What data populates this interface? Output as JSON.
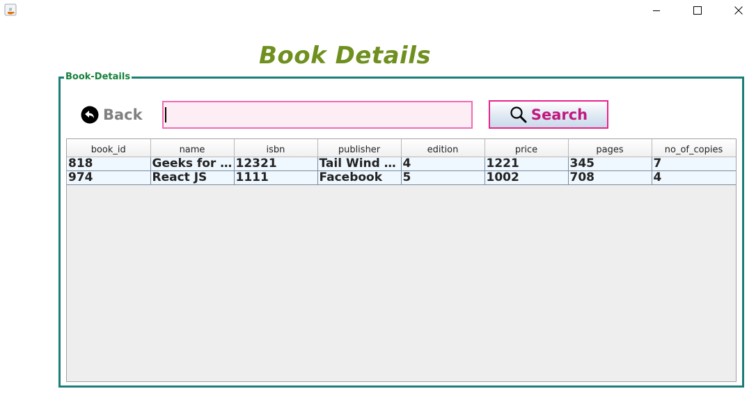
{
  "window": {
    "app_icon": "java-icon",
    "controls": [
      "minimize-icon",
      "maximize-icon",
      "close-icon"
    ]
  },
  "page": {
    "title": "Book Details"
  },
  "panel": {
    "legend": "Book-Details"
  },
  "toolbar": {
    "back_label": "Back",
    "search_label": "Search",
    "search_value": "",
    "search_placeholder": ""
  },
  "table": {
    "columns": [
      "book_id",
      "name",
      "isbn",
      "publisher",
      "edition",
      "price",
      "pages",
      "no_of_copies"
    ],
    "rows": [
      [
        "818",
        "Geeks for Geeks",
        "12321",
        "Tail Wind CSS",
        "4",
        "1221",
        "345",
        "7"
      ],
      [
        "974",
        "React JS",
        "1111",
        "Facebook",
        "5",
        "1002",
        "708",
        "4"
      ]
    ]
  },
  "colors": {
    "title": "#6f8f1f",
    "panel_border": "#1a7e76",
    "legend": "#14813a",
    "search_border": "#f06ab4",
    "search_bg": "#fdeef5",
    "button_border": "#e8218a",
    "button_text": "#c2187e",
    "row_bg": "#f0f8ff"
  }
}
